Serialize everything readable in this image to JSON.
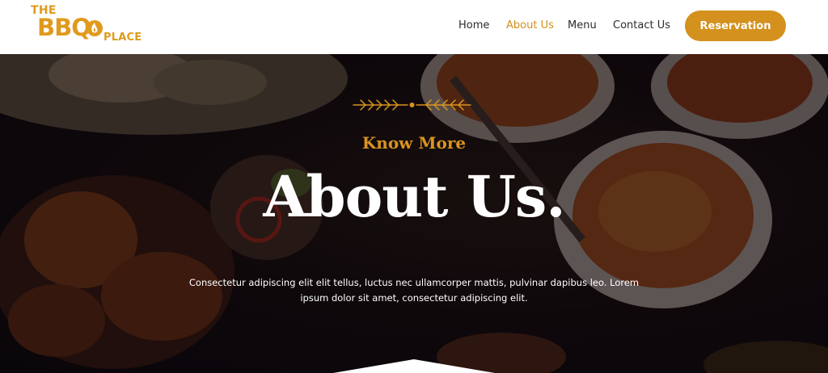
{
  "brand": {
    "logo_the": "THE",
    "logo_bbq": "BBQ",
    "logo_place": "PLACE",
    "accent_color": "#d4911e"
  },
  "nav": {
    "items": [
      {
        "label": "Home",
        "active": false
      },
      {
        "label": "About Us",
        "active": true
      },
      {
        "label": "Menu",
        "active": false
      },
      {
        "label": "Contact Us",
        "active": false
      }
    ],
    "cta_label": "Reservation"
  },
  "hero": {
    "kicker": "Know More",
    "title": "About Us.",
    "description": "Consectetur adipiscing elit elit tellus, luctus nec ullamcorper mattis, pulvinar dapibus leo. Lorem ipsum dolor sit amet, consectetur adipiscing elit.",
    "ornament_icon": "wheat-divider-icon",
    "background": "food-platter-photo"
  }
}
